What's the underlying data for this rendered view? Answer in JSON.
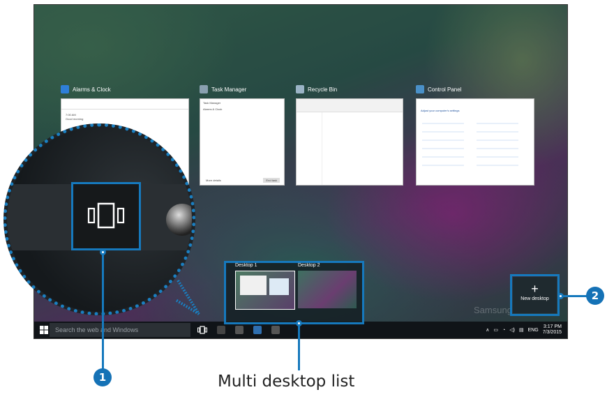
{
  "windows": [
    {
      "title": "Alarms & Clock",
      "icon_color": "#2f7fd8"
    },
    {
      "title": "Task Manager",
      "icon_color": "#8aa0b0"
    },
    {
      "title": "Recycle Bin",
      "icon_color": "#9ab3c5"
    },
    {
      "title": "Control Panel",
      "icon_color": "#4a90c8"
    }
  ],
  "alarm_content": {
    "time": "7:00 AM",
    "label": "Good morning"
  },
  "task_manager": {
    "app_item": "Alarms & Clock",
    "more_details": "More details",
    "end_task": "End task"
  },
  "control_panel": {
    "heading": "Adjust your computer's settings"
  },
  "taskbar": {
    "search_placeholder": "Search the web and Windows",
    "tray_language": "ENG",
    "time": "3:17 PM",
    "date": "7/3/2015"
  },
  "desktops": [
    {
      "label": "Desktop 1"
    },
    {
      "label": "Desktop 2"
    }
  ],
  "new_desktop": {
    "plus": "+",
    "label": "New desktop"
  },
  "callouts": {
    "one": "1",
    "two": "2"
  },
  "caption": "Multi desktop list",
  "watermark": "Samsung",
  "colors": {
    "accent": "#1679bd",
    "callout": "#1572b6",
    "taskbar": "#101418"
  }
}
